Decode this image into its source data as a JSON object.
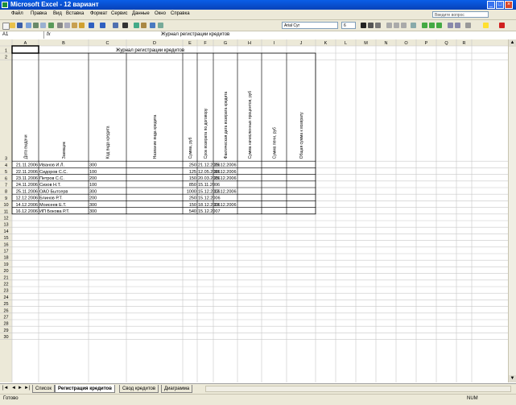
{
  "window": {
    "title": "Microsoft Excel - 12 вариант"
  },
  "menu": {
    "items": [
      "Файл",
      "Правка",
      "Вид",
      "Вставка",
      "Формат",
      "Сервис",
      "Данные",
      "Окно",
      "Справка"
    ],
    "help_placeholder": "Введите вопрос"
  },
  "toolbar": {
    "font_name": "Arial Cyr",
    "font_size": "6"
  },
  "formula_bar": {
    "cell_ref": "A1",
    "fx": "fx",
    "content": "Журнал регистрации кредитов"
  },
  "columns": [
    "A",
    "B",
    "C",
    "D",
    "E",
    "F",
    "G",
    "H",
    "I",
    "J",
    "K",
    "L",
    "M",
    "N",
    "O",
    "P",
    "Q",
    "R"
  ],
  "rows_count": 30,
  "sheet": {
    "title": "Журнал регистрации кредитов",
    "headers": [
      "Дата выдачи",
      "Заемщик",
      "Код вида кредита",
      "Название вида кредита",
      "Сумма, руб",
      "Срок возврата по договору",
      "Фактическая дата возврата кредита",
      "Сумма начисленных процентов, руб",
      "Сумма пени, руб",
      "Общая сумма к возврату"
    ],
    "data": [
      [
        "21.11.2006",
        "Иванов И.Л.",
        "300",
        "",
        "250",
        "21.12.2006",
        "25.12.2006"
      ],
      [
        "22.11.2006",
        "Сидоров С.С.",
        "100",
        "",
        "125",
        "12.05.2006",
        "30.12.2006"
      ],
      [
        "23.11.2006",
        "Петров С.С.",
        "200",
        "",
        "150",
        "20.03.2006",
        "25.12.2006"
      ],
      [
        "24.11.2006",
        "Сизов Н.Т.",
        "100",
        "",
        "850",
        "15.11.2006",
        ""
      ],
      [
        "25.11.2006",
        "ОАО Бытсерв",
        "300",
        "",
        "1000",
        "15.12.2006",
        "12.12.2006"
      ],
      [
        "12.12.2006",
        "Блинов Р.Т.",
        "200",
        "",
        "250",
        "15.12.2006",
        ""
      ],
      [
        "14.12.2006",
        "Моисеев Е.Т.",
        "300",
        "",
        "150",
        "18.12.2006",
        "19.12.2006"
      ],
      [
        "16.12.2006",
        "ИП Бокова Р.Т.",
        "300",
        "",
        "540",
        "15.12.2007",
        ""
      ]
    ]
  },
  "tabs": [
    "Список",
    "Регистрация кредитов",
    "Свод кредитов",
    "Диаграмма"
  ],
  "status": {
    "left": "Готово",
    "right": "NUM"
  }
}
